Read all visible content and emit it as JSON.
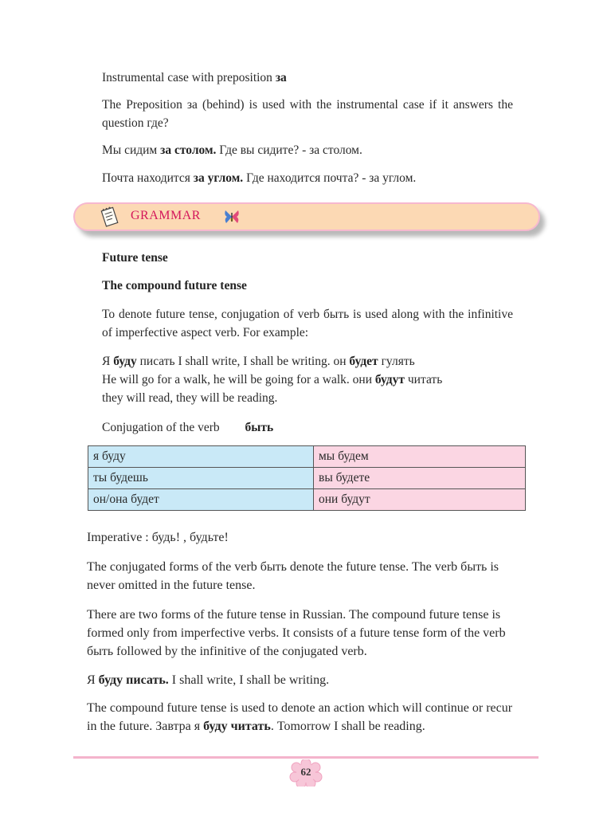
{
  "intro": {
    "heading": "Instrumental case with preposition",
    "heading_word": "за",
    "p1": "The Preposition за  (behind) is used with the instrumental case if it answers the question где?",
    "ex1": {
      "a": "Мы сидим ",
      "b": "за столом.",
      "c": " Где вы сидите?  - за столом."
    },
    "ex2": {
      "a": "Почта находится ",
      "b": "за углом.",
      "c": " Где находится почта? - за углом."
    }
  },
  "banner": {
    "label": "GRAMMAR"
  },
  "grammar": {
    "title": "Future tense",
    "subtitle": "The compound future tense",
    "p1": "To denote future tense, conjugation of verb быть is used along with the infinitive of imperfective aspect verb. For example:",
    "examples": {
      "l1a": "Я ",
      "l1b": "буду",
      "l1c": " писать    I shall write,      I shall be writing. он ",
      "l1d": "будет",
      "l1e": " гулять",
      "l2a": "He will go for a walk, he will be going for a walk.  они ",
      "l2b": "будут",
      "l2c": " читать",
      "l3": "they will read, they will be reading."
    },
    "conj_label": "Conjugation of the verb",
    "conj_verb": "быть"
  },
  "table": {
    "rows": [
      {
        "left": "я буду",
        "right": "мы будем"
      },
      {
        "left": "ты будешь",
        "right": "вы будете"
      },
      {
        "left": "он/она будет",
        "right": "они будут"
      }
    ]
  },
  "body": {
    "imperative": "Imperative : будь! , будьте!",
    "p1": "The conjugated forms of the verb  быть  denote the future tense.  The verb быть  is never omitted in the future tense.",
    "p2": "There are two forms of the future tense in Russian. The compound future tense is formed only from imperfective verbs. It consists of a future tense form of the verb  быть   followed by the infinitive of the conjugated verb.",
    "p3": {
      "a": "Я ",
      "b": "буду писать.",
      "c": " I shall write, I shall be writing."
    },
    "p4": {
      "a": "The compound future tense is used to denote an action which will continue or recur in the future.  Завтра я ",
      "b": "буду читать",
      "c": ". Tomorrow I shall be reading."
    }
  },
  "footer": {
    "page_number": "62"
  }
}
